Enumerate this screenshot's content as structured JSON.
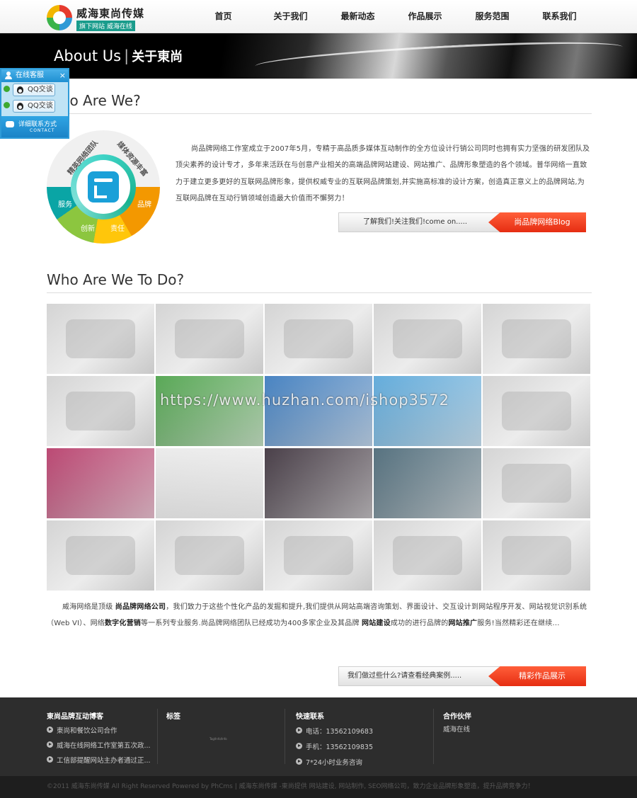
{
  "header": {
    "logo_title": "威海東尚传媒",
    "logo_sub": "旗下网站 威海在线",
    "nav": [
      "首页",
      "关于我们",
      "最新动态",
      "作品展示",
      "服务范围",
      "联系我们"
    ]
  },
  "banner": {
    "title_en": "About Us",
    "separator": "|",
    "title_cn": "关于東尚"
  },
  "service": {
    "title": "在线客服",
    "close": "×",
    "qq": [
      "QQ交谈",
      "QQ交谈"
    ],
    "contact_cn": "详细联系方式",
    "contact_en": "CONTACT"
  },
  "section1": {
    "title": "Who Are  We?",
    "wheel": {
      "team": "精英网络团队",
      "media": "媒体资源丰富",
      "service": "服务",
      "brand": "品牌",
      "create": "创新",
      "resp": "责任"
    },
    "intro": "尚品牌网络工作室成立于2007年5月，专精于高品质多媒体互动制作的全方位设计行销公司同时也拥有实力坚强的研发团队及顶尖素养的设计专才，多年来活跃在与创意产业相关的高端品牌网站建设、网站推广、品牌形象塑造的各个领域。普华网络一直致力于建立更多更好的互联网品牌形象，提供权威专业的互联网品牌策划,并实施高标准的设计方案，创造真正意义上的品牌网站,为互联网品牌在互动行销领域创造最大价值而不懈努力！",
    "cta_left": "了解我们!关注我们!come on.....",
    "cta_right": "尚品牌网络Blog"
  },
  "section2": {
    "title": "Who Are  We To Do?",
    "watermark": "https://www.huzhan.com/ishop3572",
    "desc_parts": [
      "威海网络是顶级 ",
      "尚品牌网络公司",
      "，我们致力于这些个性化产品的发掘和提升,我们提供从网站高端咨询策划、界面设计、交互设计到网站程序开发、网站视觉识别系统（Web VI）、网络",
      "数字化营销",
      "等一系列专业服务.尚品牌网络团队已经成功为400多家企业及其品牌 ",
      "网站建设",
      "成功的进行品牌的",
      "网站推广",
      "服务!当然精彩还在继续..."
    ],
    "cta_left": "我们做过些什么?请查看经典案例.....",
    "cta_right": "精彩作品展示"
  },
  "gallery_colors": [
    "gray",
    "gray",
    "gray",
    "gray",
    "gray",
    "gray",
    "#3d9a3a",
    "#2a6fb8",
    "#4a9fd6",
    "gray",
    "#b02a5c",
    "#e8e8e8",
    "#2b1f2a",
    "#3a5a6a",
    "gray",
    "gray",
    "gray",
    "gray",
    "gray",
    "gray"
  ],
  "footer": {
    "col1_title": "東尚品牌互动博客",
    "col1_items": [
      "東尚和餐饮公司合作",
      "威海在线网络工作室第五次政...",
      "工信部提醒网站主办者通过正..."
    ],
    "col2_title": "标签",
    "col2_tag": "Tag/Info/Info",
    "col3_title": "快速联系",
    "col3_items": [
      "电话：13562109683",
      "手机：13562109835",
      "7*24小时业务咨询"
    ],
    "col4_title": "合作伙伴",
    "col4_items": [
      "威海在线"
    ]
  },
  "copyright": "©2011 威海东尚传媒  All Right Reserved Powered by PhCms | 威海东尚传媒 -東尚提供 网站建设, 网站制作, SEO网络公司，致力企业品牌形象塑造，提升品牌竞争力！"
}
